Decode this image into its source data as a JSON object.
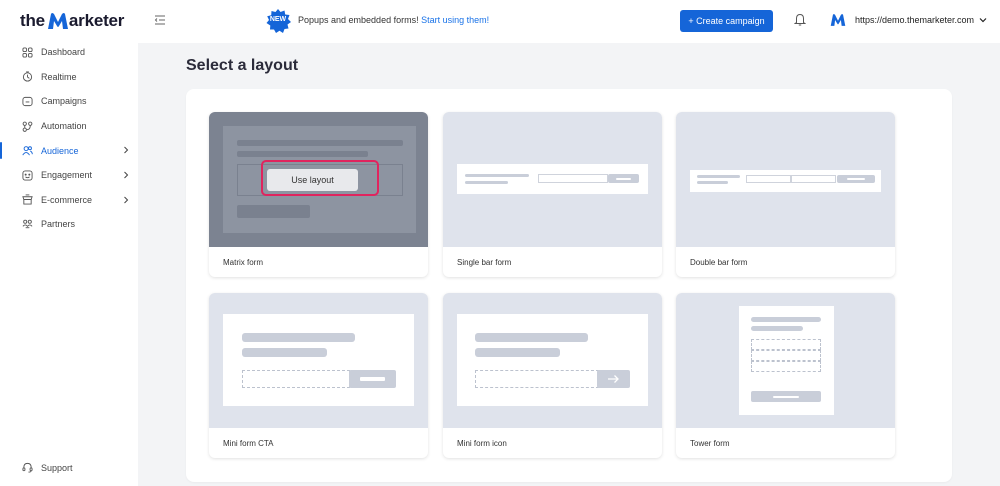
{
  "brand": {
    "logo_the": "the",
    "logo_rest": "arketer"
  },
  "sidebar": {
    "items": [
      {
        "label": "Dashboard",
        "icon": "dashboard-icon"
      },
      {
        "label": "Realtime",
        "icon": "realtime-icon"
      },
      {
        "label": "Campaigns",
        "icon": "campaigns-icon"
      },
      {
        "label": "Automation",
        "icon": "automation-icon"
      },
      {
        "label": "Audience",
        "icon": "audience-icon",
        "active": true,
        "has_submenu": true
      },
      {
        "label": "Engagement",
        "icon": "engagement-icon",
        "has_submenu": true
      },
      {
        "label": "E-commerce",
        "icon": "ecommerce-icon",
        "has_submenu": true
      },
      {
        "label": "Partners",
        "icon": "partners-icon"
      }
    ],
    "support_label": "Support"
  },
  "topbar": {
    "badge": "NEW",
    "announcement": "Popups and embedded forms!",
    "announcement_link": "Start using them!",
    "create_button": "+ Create campaign",
    "account": "https://demo.themarketer.com"
  },
  "main": {
    "title": "Select a layout",
    "use_layout_label": "Use layout",
    "layouts": [
      {
        "name": "Matrix form",
        "hovered": true
      },
      {
        "name": "Single bar form"
      },
      {
        "name": "Double bar form"
      },
      {
        "name": "Mini form CTA"
      },
      {
        "name": "Mini form icon"
      },
      {
        "name": "Tower form"
      }
    ]
  },
  "colors": {
    "accent": "#1565d8",
    "highlight": "#e0245e",
    "placeholder": "#dfe3ec"
  }
}
